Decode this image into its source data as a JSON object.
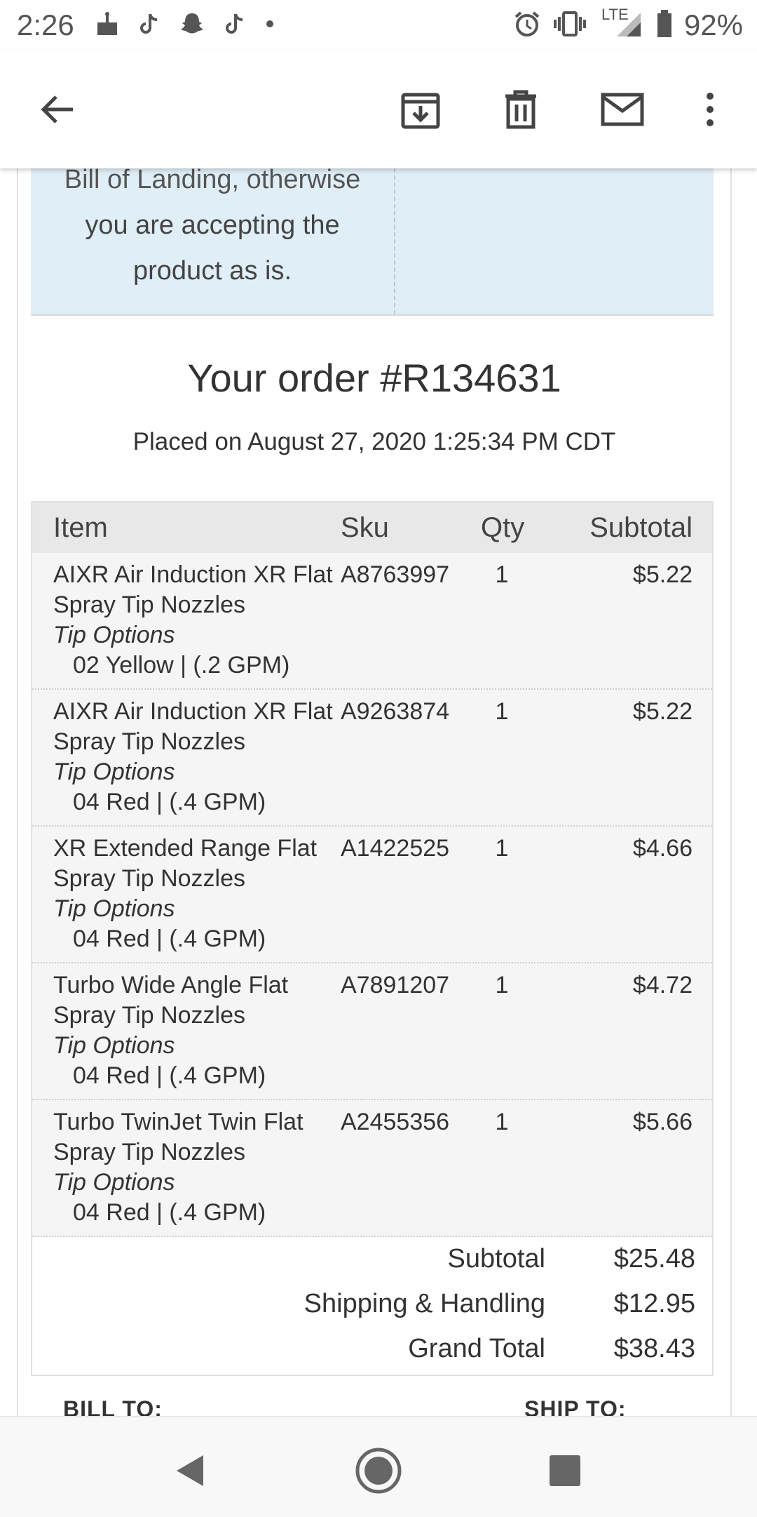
{
  "status_bar": {
    "time": "2:26",
    "network": "LTE",
    "battery": "92%",
    "icons_left": [
      "cake-icon",
      "tiktok-icon",
      "snapchat-icon",
      "tiktok-icon",
      "dot-icon"
    ],
    "icons_right": [
      "alarm-icon",
      "vibrate-icon",
      "signal-icon",
      "battery-icon"
    ]
  },
  "app_bar": {
    "icons": [
      "back-arrow-icon",
      "archive-icon",
      "trash-icon",
      "mail-icon",
      "more-vert-icon"
    ]
  },
  "notice": {
    "line1": "Bill of Landing, otherwise",
    "line2": "you are accepting the",
    "line3": "product as is."
  },
  "order": {
    "title": "Your order #R134631",
    "placed": "Placed on August 27, 2020 1:25:34 PM CDT"
  },
  "table": {
    "headers": {
      "item": "Item",
      "sku": "Sku",
      "qty": "Qty",
      "subtotal": "Subtotal"
    },
    "rows": [
      {
        "name": "AIXR Air Induction XR Flat Spray Tip Nozzles",
        "option_label": "Tip Options",
        "option_value": "02 Yellow | (.2 GPM)",
        "sku": "A8763997",
        "qty": "1",
        "subtotal": "$5.22"
      },
      {
        "name": "AIXR Air Induction XR Flat Spray Tip Nozzles",
        "option_label": "Tip Options",
        "option_value": "04 Red | (.4 GPM)",
        "sku": "A9263874",
        "qty": "1",
        "subtotal": "$5.22"
      },
      {
        "name": "XR Extended Range Flat Spray Tip Nozzles",
        "option_label": "Tip Options",
        "option_value": "04 Red | (.4 GPM)",
        "sku": "A1422525",
        "qty": "1",
        "subtotal": "$4.66"
      },
      {
        "name": "Turbo Wide Angle Flat Spray Tip Nozzles",
        "option_label": "Tip Options",
        "option_value": "04 Red | (.4 GPM)",
        "sku": "A7891207",
        "qty": "1",
        "subtotal": "$4.72"
      },
      {
        "name": "Turbo TwinJet Twin Flat Spray Tip Nozzles",
        "option_label": "Tip Options",
        "option_value": "04 Red | (.4 GPM)",
        "sku": "A2455356",
        "qty": "1",
        "subtotal": "$5.66"
      }
    ]
  },
  "totals": {
    "subtotal_label": "Subtotal",
    "subtotal_value": "$25.48",
    "shipping_label": "Shipping & Handling",
    "shipping_value": "$12.95",
    "grand_label": "Grand Total",
    "grand_value": "$38.43"
  },
  "addresses": {
    "bill_to": "BILL TO:",
    "ship_to": "SHIP TO:"
  },
  "nav_bar": {
    "icons": [
      "back-triangle-icon",
      "home-circle-icon",
      "recents-square-icon"
    ]
  },
  "colors": {
    "notice_bg": "#e0eef7",
    "table_head_bg": "#e8e8e8",
    "row_bg": "#f5f5f5"
  }
}
